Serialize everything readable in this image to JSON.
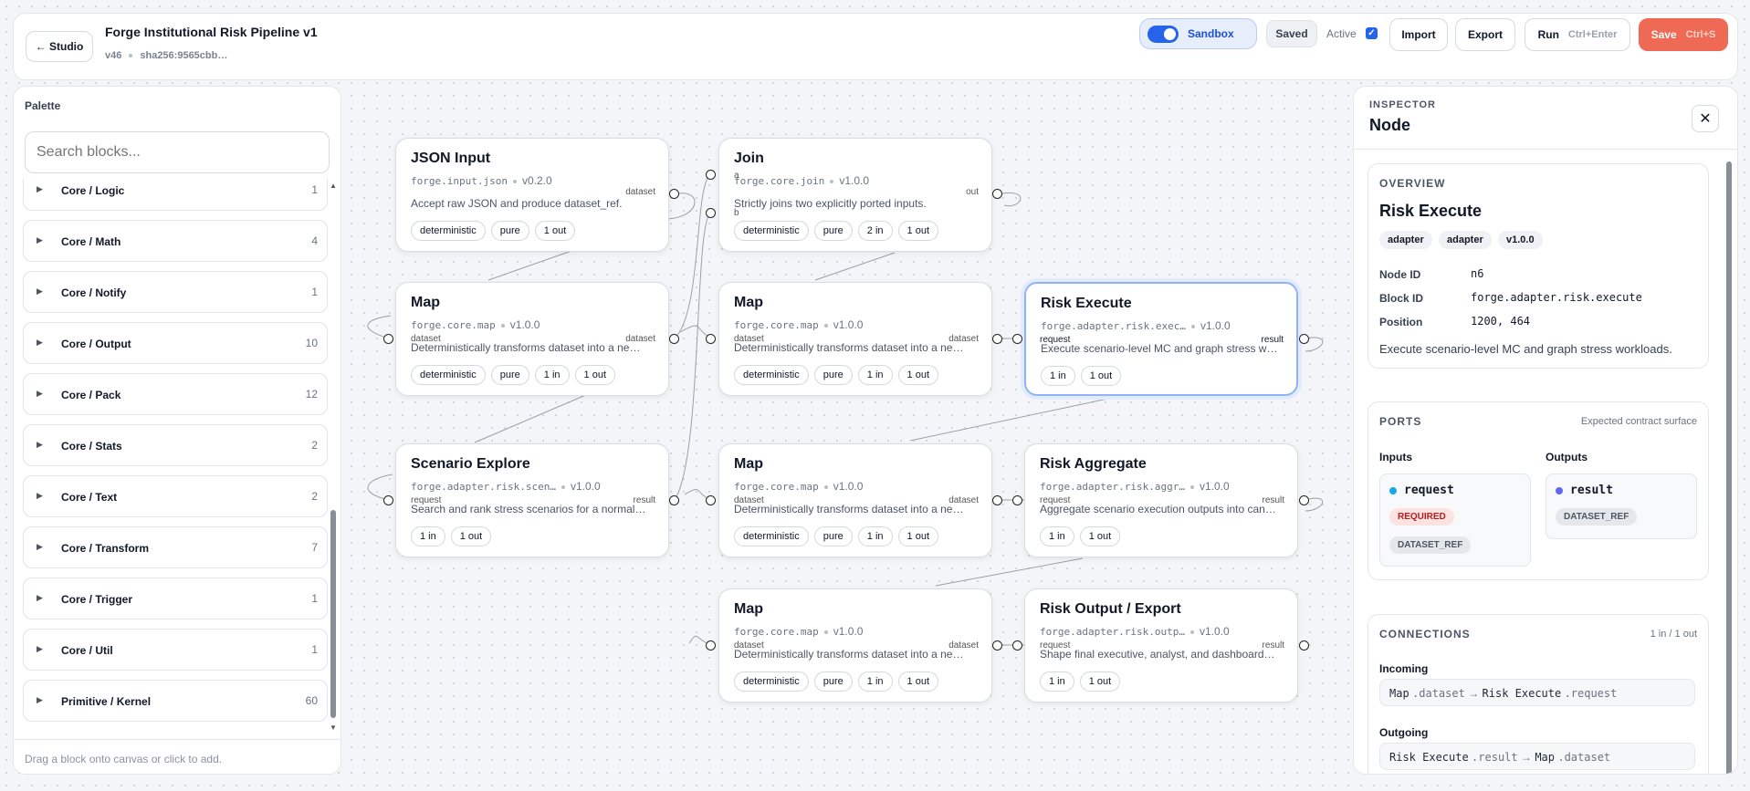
{
  "header": {
    "back_label": "← Studio",
    "title": "Forge Institutional Risk Pipeline v1",
    "version": "v46",
    "hash": "sha256:9565cbb…",
    "sandbox_label": "Sandbox",
    "saved_label": "Saved",
    "active_label": "Active",
    "active_checked": true,
    "import_label": "Import",
    "export_label": "Export",
    "run_label": "Run",
    "run_shortcut": "Ctrl+Enter",
    "save_label": "Save",
    "save_shortcut": "Ctrl+S"
  },
  "palette": {
    "title": "Palette",
    "search_placeholder": "Search blocks...",
    "footer": "Drag a block onto canvas or click to add.",
    "groups": [
      {
        "label": "Core / Logic",
        "count": "1"
      },
      {
        "label": "Core / Math",
        "count": "4"
      },
      {
        "label": "Core / Notify",
        "count": "1"
      },
      {
        "label": "Core / Output",
        "count": "10"
      },
      {
        "label": "Core / Pack",
        "count": "12"
      },
      {
        "label": "Core / Stats",
        "count": "2"
      },
      {
        "label": "Core / Text",
        "count": "2"
      },
      {
        "label": "Core / Transform",
        "count": "7"
      },
      {
        "label": "Core / Trigger",
        "count": "1"
      },
      {
        "label": "Core / Util",
        "count": "1"
      },
      {
        "label": "Primitive / Kernel",
        "count": "60"
      }
    ]
  },
  "nodes": [
    {
      "title": "JSON Input",
      "block": "forge.input.json",
      "version": "v0.2.0",
      "desc": "Accept raw JSON and produce dataset_ref.",
      "tags": [
        "deterministic",
        "pure",
        "1 out"
      ]
    },
    {
      "title": "Join",
      "block": "forge.core.join",
      "version": "v1.0.0",
      "desc": "Strictly joins two explicitly ported inputs.",
      "tags": [
        "deterministic",
        "pure",
        "2 in",
        "1 out"
      ]
    },
    {
      "title": "Map",
      "block": "forge.core.map",
      "version": "v1.0.0",
      "desc": "Deterministically transforms dataset into a new dataset.",
      "tags": [
        "deterministic",
        "pure",
        "1 in",
        "1 out"
      ]
    },
    {
      "title": "Map",
      "block": "forge.core.map",
      "version": "v1.0.0",
      "desc": "Deterministically transforms dataset into a new dataset.",
      "tags": [
        "deterministic",
        "pure",
        "1 in",
        "1 out"
      ]
    },
    {
      "title": "Risk Execute",
      "block": "forge.adapter.risk.exec…",
      "version": "v1.0.0",
      "desc": "Execute scenario-level MC and graph stress workloads.",
      "tags": [
        "1 in",
        "1 out"
      ]
    },
    {
      "title": "Scenario Explore",
      "block": "forge.adapter.risk.scen…",
      "version": "v1.0.0",
      "desc": "Search and rank stress scenarios for a normalized dataset.",
      "tags": [
        "1 in",
        "1 out"
      ]
    },
    {
      "title": "Map",
      "block": "forge.core.map",
      "version": "v1.0.0",
      "desc": "Deterministically transforms dataset into a new dataset.",
      "tags": [
        "deterministic",
        "pure",
        "1 in",
        "1 out"
      ]
    },
    {
      "title": "Risk Aggregate",
      "block": "forge.adapter.risk.aggr…",
      "version": "v1.0.0",
      "desc": "Aggregate scenario execution outputs into canonical results.",
      "tags": [
        "1 in",
        "1 out"
      ]
    },
    {
      "title": "Map",
      "block": "forge.core.map",
      "version": "v1.0.0",
      "desc": "Deterministically transforms dataset into a new dataset.",
      "tags": [
        "deterministic",
        "pure",
        "1 in",
        "1 out"
      ]
    },
    {
      "title": "Risk Output / Export",
      "block": "forge.adapter.risk.outp…",
      "version": "v1.0.0",
      "desc": "Shape final executive, analyst, and dashboard outputs.",
      "tags": [
        "1 in",
        "1 out"
      ]
    }
  ],
  "pins": {
    "dataset": "dataset",
    "out": "out",
    "a": "a",
    "b": "b",
    "request": "request",
    "result": "result"
  },
  "inspector": {
    "label": "INSPECTOR",
    "title": "Node",
    "overview": {
      "heading": "OVERVIEW",
      "name": "Risk Execute",
      "badges": [
        "adapter",
        "adapter",
        "v1.0.0"
      ],
      "node_id_label": "Node ID",
      "node_id": "n6",
      "block_id_label": "Block ID",
      "block_id": "forge.adapter.risk.execute",
      "position_label": "Position",
      "position": "1200, 464",
      "description": "Execute scenario-level MC and graph stress workloads."
    },
    "ports": {
      "heading": "PORTS",
      "note": "Expected contract surface",
      "inputs_label": "Inputs",
      "outputs_label": "Outputs",
      "input": {
        "name": "request",
        "required": "REQUIRED",
        "type": "DATASET_REF"
      },
      "output": {
        "name": "result",
        "type": "DATASET_REF"
      }
    },
    "connections": {
      "heading": "CONNECTIONS",
      "count": "1 in / 1 out",
      "incoming_label": "Incoming",
      "incoming": {
        "from": "Map",
        "from_port": ".dataset",
        "arrow": "→",
        "to": "Risk Execute",
        "to_port": ".request"
      },
      "outgoing_label": "Outgoing",
      "outgoing": {
        "from": "Risk Execute",
        "from_port": ".result",
        "arrow": "→",
        "to": "Map",
        "to_port": ".dataset"
      }
    }
  },
  "colors": {
    "accent": "#2563eb",
    "save": "#ef6a55",
    "required": "#b91c1c",
    "input_dot": "#1aa6e8",
    "output_dot": "#6366f1"
  }
}
